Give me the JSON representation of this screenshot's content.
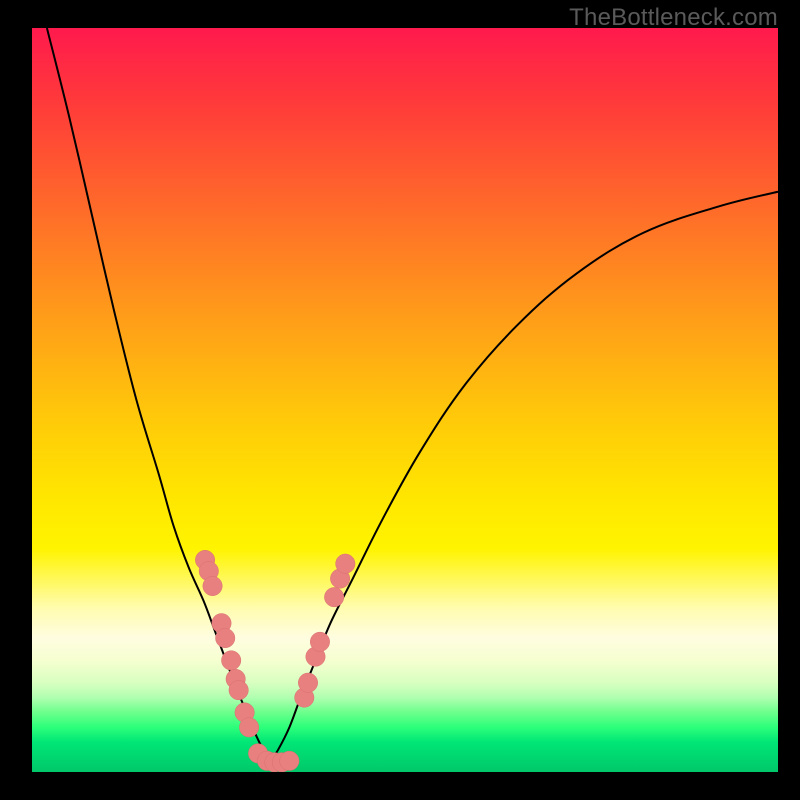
{
  "watermark": "TheBottleneck.com",
  "chart_data": {
    "type": "line",
    "title": "",
    "xlabel": "",
    "ylabel": "",
    "xlim": [
      0,
      100
    ],
    "ylim": [
      0,
      100
    ],
    "series": [
      {
        "name": "left-curve",
        "x": [
          2,
          5,
          8,
          11,
          14,
          17,
          19,
          21,
          23,
          24.5,
          26,
          27.5,
          29,
          30,
          31,
          32
        ],
        "y": [
          100,
          88,
          75,
          62,
          50,
          40,
          33,
          27.5,
          23,
          19,
          15,
          11,
          7.5,
          5,
          3,
          1.5
        ]
      },
      {
        "name": "right-curve",
        "x": [
          32,
          33,
          34.5,
          36,
          38,
          40,
          43,
          47,
          52,
          58,
          65,
          73,
          82,
          92,
          100
        ],
        "y": [
          1.5,
          3,
          6,
          10,
          15,
          20,
          26,
          34,
          43,
          52,
          60,
          67,
          72.5,
          76,
          78
        ]
      }
    ],
    "points": [
      {
        "name": "left-cluster",
        "coords": [
          [
            23.2,
            28.5
          ],
          [
            23.7,
            27.0
          ],
          [
            24.2,
            25.0
          ],
          [
            25.4,
            20.0
          ],
          [
            25.9,
            18.0
          ],
          [
            26.7,
            15.0
          ],
          [
            27.3,
            12.5
          ],
          [
            27.7,
            11.0
          ],
          [
            28.5,
            8.0
          ],
          [
            29.1,
            6.0
          ],
          [
            30.3,
            2.5
          ],
          [
            31.5,
            1.5
          ],
          [
            32.5,
            1.3
          ],
          [
            33.5,
            1.3
          ],
          [
            34.5,
            1.5
          ]
        ]
      },
      {
        "name": "right-cluster",
        "coords": [
          [
            36.5,
            10.0
          ],
          [
            37.0,
            12.0
          ],
          [
            38.0,
            15.5
          ],
          [
            38.6,
            17.5
          ],
          [
            40.5,
            23.5
          ],
          [
            41.3,
            26.0
          ],
          [
            42.0,
            28.0
          ]
        ]
      }
    ],
    "point_radius": 1.3
  }
}
